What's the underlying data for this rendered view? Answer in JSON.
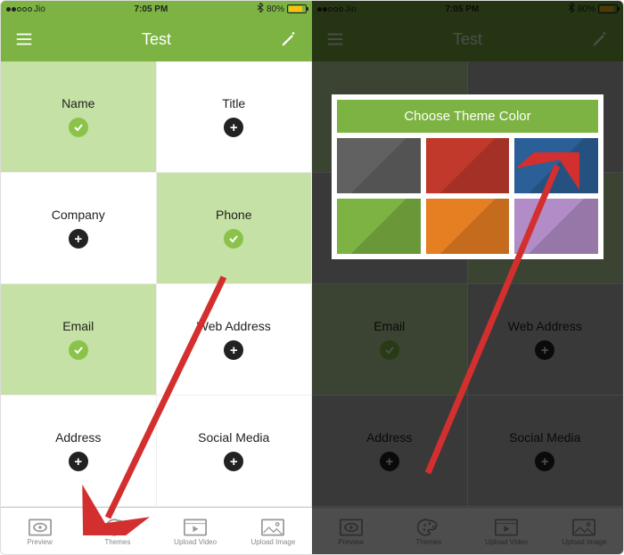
{
  "status": {
    "carrier": "Jio",
    "time": "7:05 PM",
    "battery": "80%"
  },
  "header": {
    "title": "Test"
  },
  "cells": [
    {
      "label": "Name",
      "selected": true
    },
    {
      "label": "Title",
      "selected": false
    },
    {
      "label": "Company",
      "selected": false
    },
    {
      "label": "Phone",
      "selected": true
    },
    {
      "label": "Email",
      "selected": true
    },
    {
      "label": "Web Address",
      "selected": false
    },
    {
      "label": "Address",
      "selected": false
    },
    {
      "label": "Social Media",
      "selected": false
    }
  ],
  "tabs": [
    {
      "label": "Preview"
    },
    {
      "label": "Themes"
    },
    {
      "label": "Upload Video"
    },
    {
      "label": "Upload Image"
    }
  ],
  "popup": {
    "title": "Choose Theme Color",
    "colors": [
      "#616161",
      "#c0392b",
      "#2b5f97",
      "#7cb342",
      "#e67e22",
      "#b18cc6"
    ]
  }
}
